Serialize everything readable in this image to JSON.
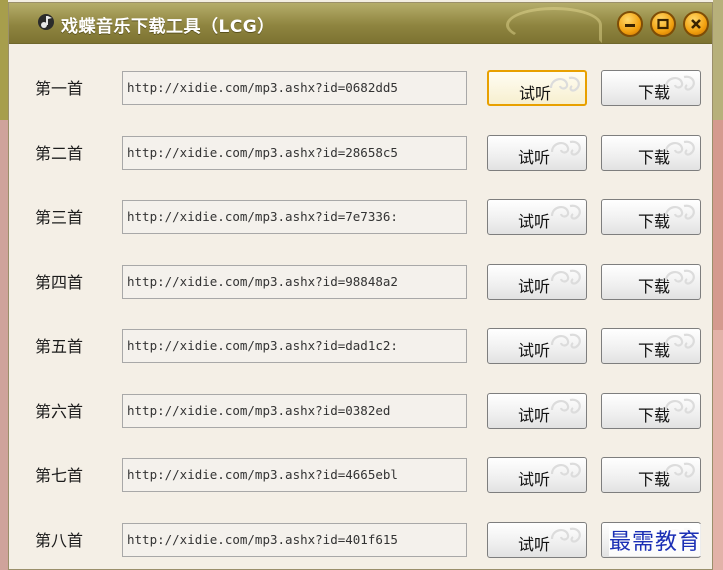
{
  "window": {
    "title": "戏蝶音乐下载工具（LCG）"
  },
  "buttons": {
    "listen": "试听",
    "download": "下载"
  },
  "rows": [
    {
      "label": "第一首",
      "url": "http://xidie.com/mp3.ashx?id=0682dd5",
      "listen": "试听",
      "download": "下载"
    },
    {
      "label": "第二首",
      "url": "http://xidie.com/mp3.ashx?id=28658c5",
      "listen": "试听",
      "download": "下载"
    },
    {
      "label": "第三首",
      "url": "http://xidie.com/mp3.ashx?id=7e7336:",
      "listen": "试听",
      "download": "下载"
    },
    {
      "label": "第四首",
      "url": "http://xidie.com/mp3.ashx?id=98848a2",
      "listen": "试听",
      "download": "下载"
    },
    {
      "label": "第五首",
      "url": "http://xidie.com/mp3.ashx?id=dad1c2:",
      "listen": "试听",
      "download": "下载"
    },
    {
      "label": "第六首",
      "url": "http://xidie.com/mp3.ashx?id=0382ed",
      "listen": "试听",
      "download": "下载"
    },
    {
      "label": "第七首",
      "url": "http://xidie.com/mp3.ashx?id=4665ebl",
      "listen": "试听",
      "download": "下载"
    },
    {
      "label": "第八首",
      "url": "http://xidie.com/mp3.ashx?id=401f615",
      "listen": "试听",
      "download": ""
    }
  ],
  "watermark": "最需教育",
  "colors": {
    "titlebar": "#8f8540",
    "window_button": "#f2a10f",
    "focus_border": "#e8a000",
    "watermark": "#1b2fb5"
  },
  "icons": {
    "app": "music-note-icon",
    "minimize": "minimize-icon",
    "maximize": "maximize-icon",
    "close": "close-icon"
  }
}
